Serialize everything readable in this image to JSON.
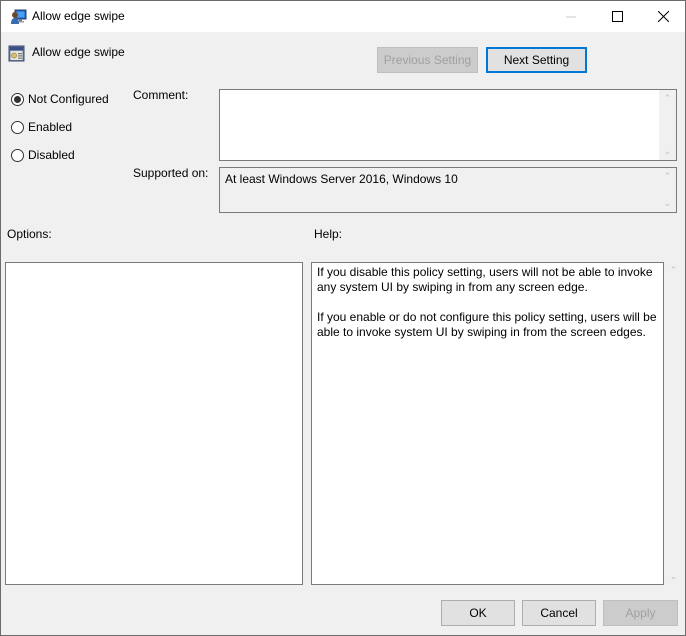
{
  "window": {
    "title": "Allow edge swipe",
    "controls": {
      "minimize": "minimize-icon",
      "maximize": "maximize-icon",
      "close": "close-icon"
    }
  },
  "header": {
    "setting_name": "Allow edge swipe",
    "previous_label": "Previous Setting",
    "next_label": "Next Setting"
  },
  "state": {
    "options": [
      {
        "label": "Not Configured",
        "checked": true
      },
      {
        "label": "Enabled",
        "checked": false
      },
      {
        "label": "Disabled",
        "checked": false
      }
    ]
  },
  "fields": {
    "comment_label": "Comment:",
    "comment_value": "",
    "supported_label": "Supported on:",
    "supported_value": "At least Windows Server 2016, Windows 10"
  },
  "panels": {
    "options_label": "Options:",
    "help_label": "Help:",
    "help_paragraphs": [
      "If you disable this policy setting, users will not be able to invoke any system UI by swiping in from any screen edge.",
      "If you enable or do not configure this policy setting, users will be able to invoke system UI by swiping in from the screen edges."
    ]
  },
  "footer": {
    "ok_label": "OK",
    "cancel_label": "Cancel",
    "apply_label": "Apply"
  },
  "colors": {
    "accent": "#0078d7",
    "background": "#f0f0f0",
    "disabled_text": "#a0a0a0"
  }
}
